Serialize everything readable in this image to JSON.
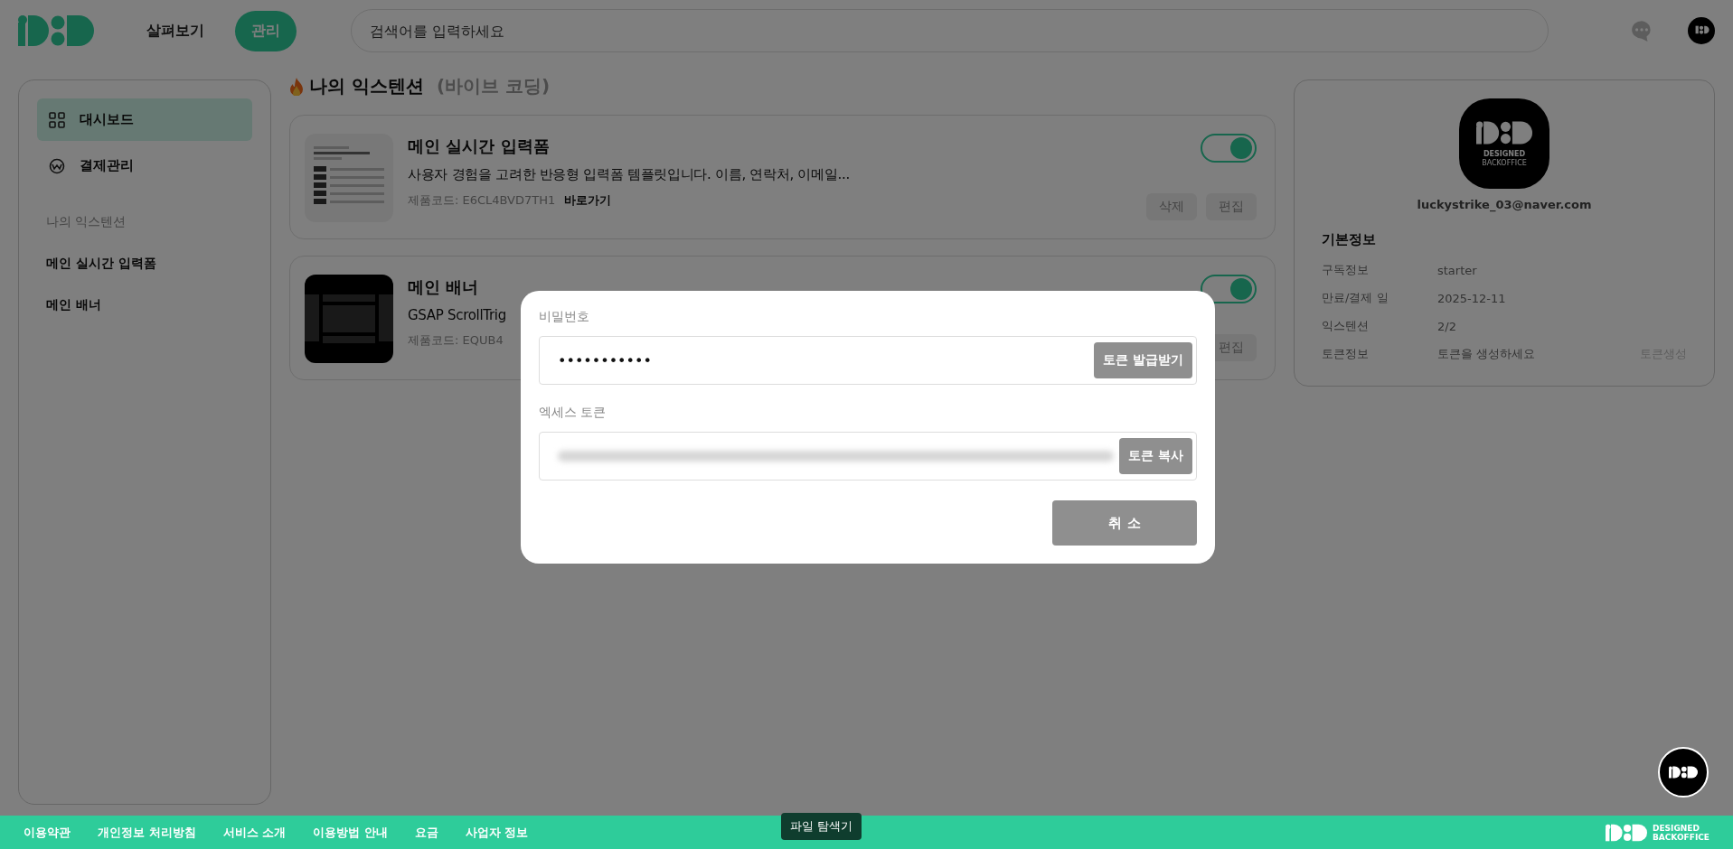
{
  "header": {
    "nav": [
      {
        "label": "살펴보기",
        "selected": false
      },
      {
        "label": "관리",
        "selected": true
      }
    ],
    "search": {
      "placeholder": "검색어를 입력하세요"
    }
  },
  "sidebar": {
    "items": [
      {
        "label": "대시보드",
        "selected": true
      },
      {
        "label": "결제관리",
        "selected": false
      }
    ],
    "section_title": "나의 익스텐션",
    "extensions": [
      "메인 실시간 입력폼",
      "메인 배너"
    ]
  },
  "main": {
    "title": "나의 익스텐션",
    "subtitle": "(바이브 코딩)",
    "cards": [
      {
        "kind": "form",
        "name": "메인 실시간 입력폼",
        "description": "사용자 경험을 고려한 반응형 입력폼 템플릿입니다. 이름, 연락처, 이메일...",
        "code": "제품코드: E6CL4BVD7TH1",
        "link": "바로가기",
        "enabled": true,
        "buttons": [
          "삭제",
          "편집"
        ]
      },
      {
        "kind": "banner",
        "name": "메인 배너",
        "description": "GSAP ScrollTrig",
        "code": "제품코드: EQUB4",
        "enabled": true,
        "buttons": [
          "편집"
        ]
      }
    ]
  },
  "profile": {
    "logo_text": [
      "DESIGNED",
      "BACKOFFICE"
    ],
    "email": "luckystrike_03@naver.com",
    "section": "기본정보",
    "rows": [
      {
        "label": "구독정보",
        "value": "starter"
      },
      {
        "label": "만료/결제 일",
        "value": "2025-12-11"
      },
      {
        "label": "익스텐션",
        "value": "2/2"
      },
      {
        "label": "토큰정보",
        "value": "토큰을 생성하세요",
        "action": "토큰생성"
      }
    ]
  },
  "modal": {
    "password_label": "비밀번호",
    "password_value": "•••••••••••",
    "issue_button": "토큰 발급받기",
    "token_label": "엑세스 토큰",
    "copy_button": "토큰 복사",
    "cancel_button": "취 소"
  },
  "footer": {
    "links": [
      "이용약관",
      "개인정보 처리방침",
      "서비스 소개",
      "이용방법 안내",
      "요금",
      "사업자 정보"
    ],
    "tooltip": "파일 탐색기",
    "logo_text": [
      "DESIGNED",
      "BACKOFFICE"
    ]
  }
}
